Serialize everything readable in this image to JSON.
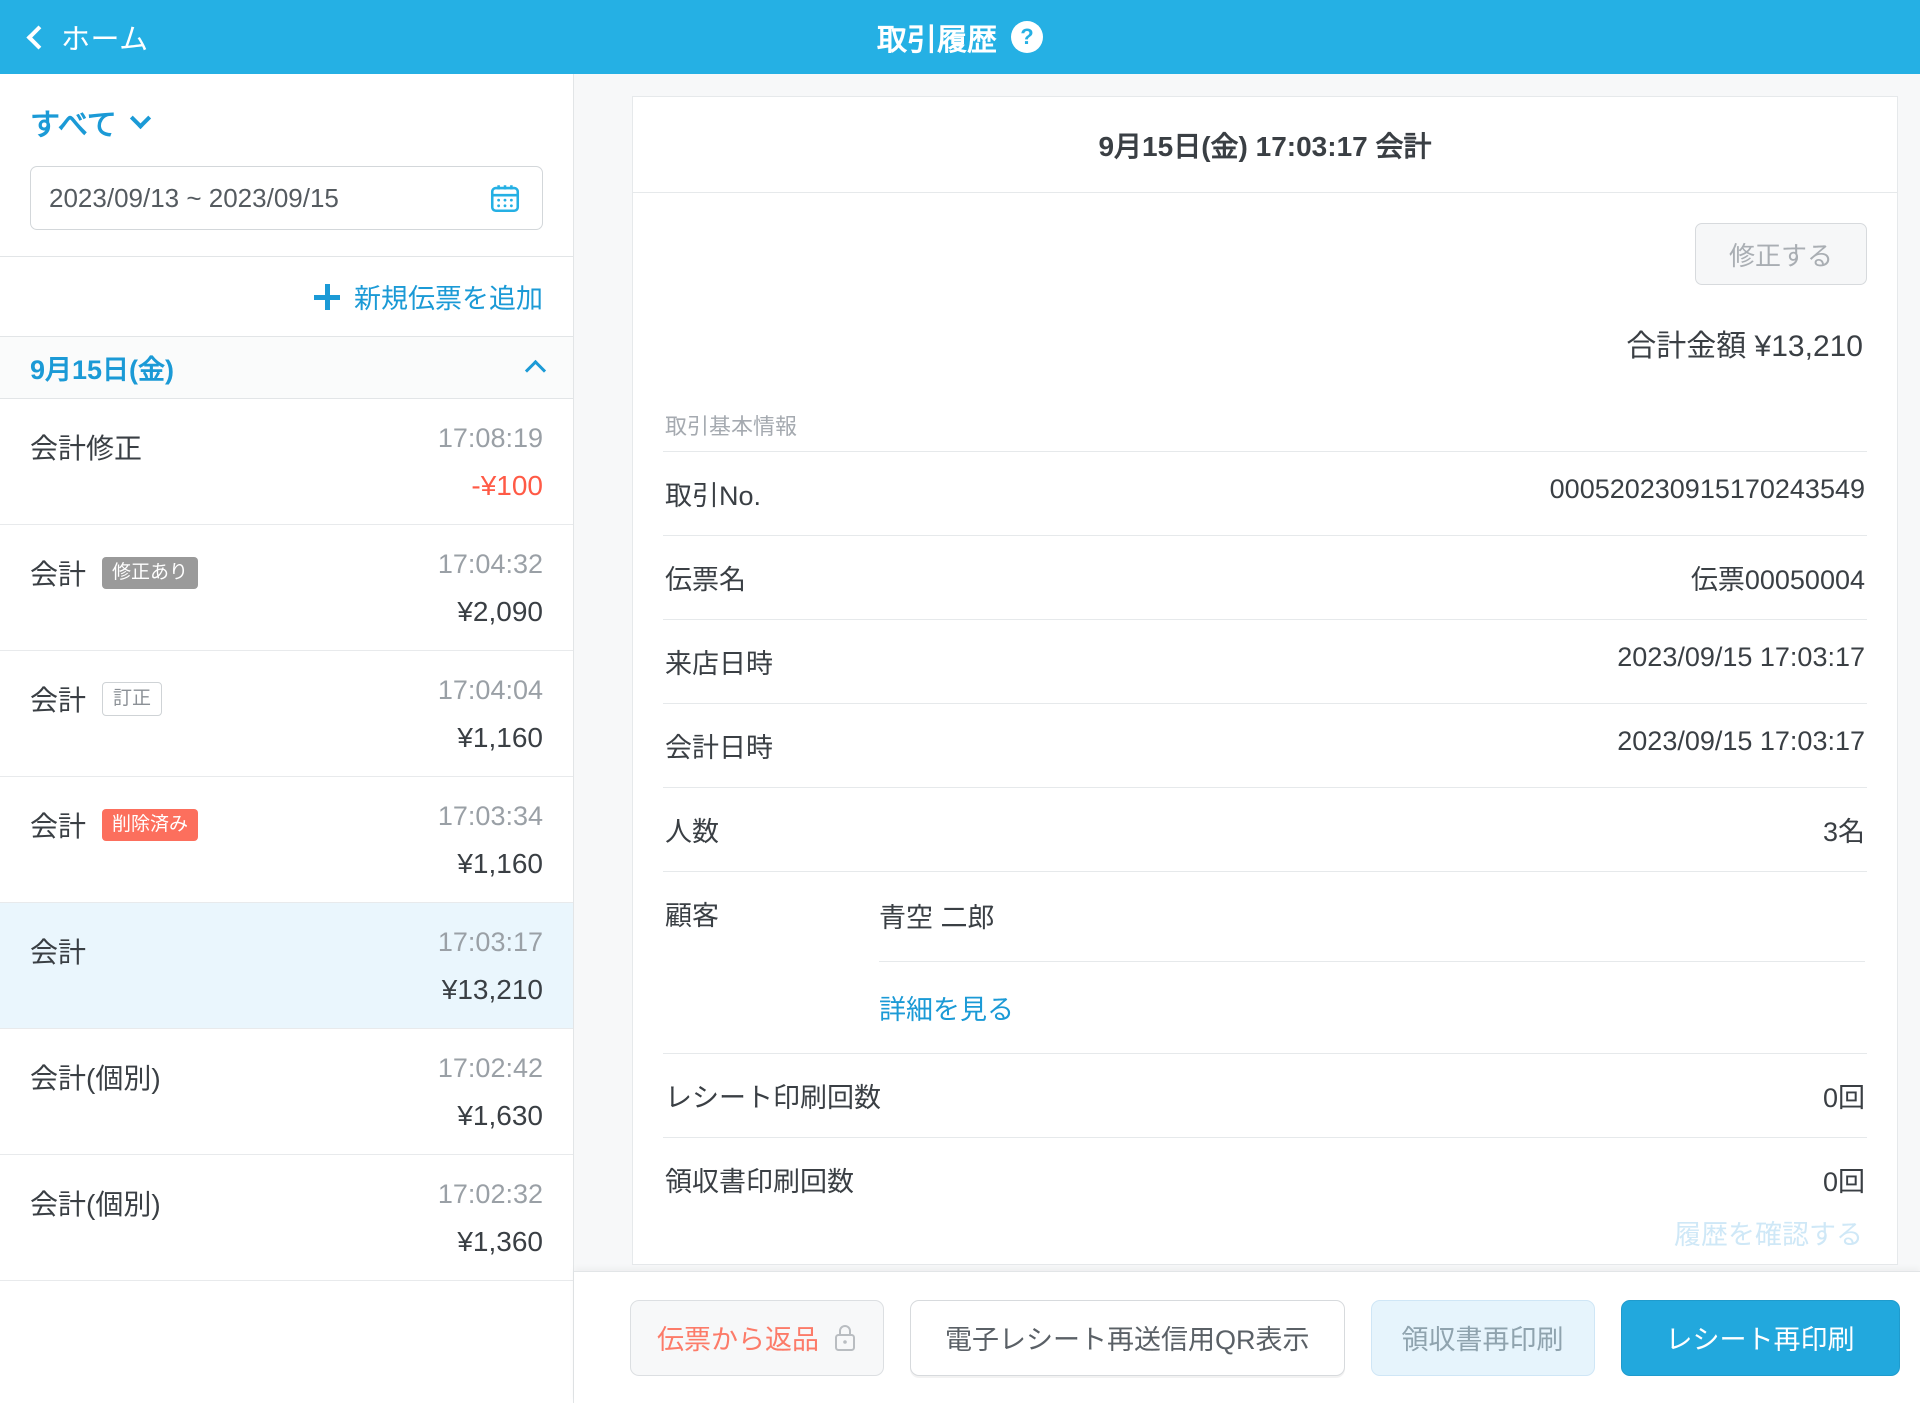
{
  "topbar": {
    "back_label": "ホーム",
    "title": "取引履歴",
    "help_glyph": "?"
  },
  "sidebar": {
    "filter_label": "すべて",
    "date_range": "2023/09/13 ~ 2023/09/15",
    "date_range_placeholder": "2023/09/13 ~ 2023/09/15",
    "add_slip_label": "新規伝票を追加",
    "day_group_label": "9月15日(金)",
    "transactions": [
      {
        "type": "会計修正",
        "badge": "",
        "badge_style": "",
        "time": "17:08:19",
        "amount": "-¥100",
        "negative": true,
        "selected": false
      },
      {
        "type": "会計",
        "badge": "修正あり",
        "badge_style": "gray",
        "time": "17:04:32",
        "amount": "¥2,090",
        "negative": false,
        "selected": false
      },
      {
        "type": "会計",
        "badge": "訂正",
        "badge_style": "outline",
        "time": "17:04:04",
        "amount": "¥1,160",
        "negative": false,
        "selected": false
      },
      {
        "type": "会計",
        "badge": "削除済み",
        "badge_style": "red",
        "time": "17:03:34",
        "amount": "¥1,160",
        "negative": false,
        "selected": false
      },
      {
        "type": "会計",
        "badge": "",
        "badge_style": "",
        "time": "17:03:17",
        "amount": "¥13,210",
        "negative": false,
        "selected": true
      },
      {
        "type": "会計(個別)",
        "badge": "",
        "badge_style": "",
        "time": "17:02:42",
        "amount": "¥1,630",
        "negative": false,
        "selected": false
      },
      {
        "type": "会計(個別)",
        "badge": "",
        "badge_style": "",
        "time": "17:02:32",
        "amount": "¥1,360",
        "negative": false,
        "selected": false
      }
    ]
  },
  "detail": {
    "header_title": "9月15日(金) 17:03:17 会計",
    "edit_button": "修正する",
    "total_label": "合計金額 ¥13,210",
    "section_label": "取引基本情報",
    "rows": [
      {
        "key": "取引No.",
        "value": "000520230915170243549"
      },
      {
        "key": "伝票名",
        "value": "伝票00050004"
      },
      {
        "key": "来店日時",
        "value": "2023/09/15 17:03:17"
      },
      {
        "key": "会計日時",
        "value": "2023/09/15 17:03:17"
      },
      {
        "key": "人数",
        "value": "3名"
      }
    ],
    "customer_key": "顧客",
    "customer_name": "青空 二郎",
    "customer_link": "詳細を見る",
    "print_rows": [
      {
        "key": "レシート印刷回数",
        "value": "0回"
      },
      {
        "key": "領収書印刷回数",
        "value": "0回"
      }
    ],
    "history_link": "履歴を確認する"
  },
  "footer": {
    "return_button": "伝票から返品",
    "qr_button": "電子レシート再送信用QR表示",
    "reprint_receipt_button": "領収書再印刷",
    "reprint_slip_button": "レシート再印刷"
  },
  "colors": {
    "accent": "#25b0e4",
    "link": "#1b9ad6",
    "danger": "#ff5a46",
    "badge_gray": "#9a9a9a",
    "badge_red": "#fc6f5d",
    "selected_row": "#eaf6fd"
  }
}
